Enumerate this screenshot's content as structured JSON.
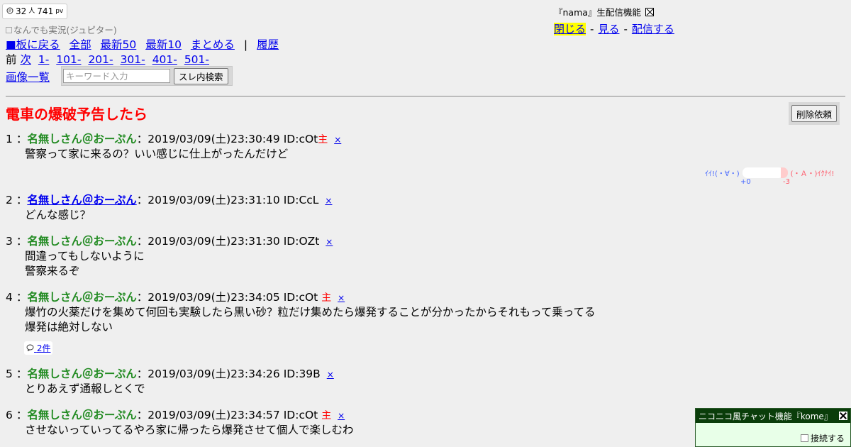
{
  "counter": {
    "people": "32",
    "people_unit": "人",
    "pv": "741",
    "pv_unit": "pv"
  },
  "board_name": "なんでも実況(ジュピター)",
  "nav": {
    "back_to_board": "■板に戻る",
    "all": "全部",
    "latest50": "最新50",
    "latest10": "最新10",
    "summarize": "まとめる",
    "separator": "|",
    "history": "履歴",
    "prev": "前",
    "next": "次",
    "ranges": [
      "1-",
      "101-",
      "201-",
      "301-",
      "401-",
      "501-"
    ],
    "gallery": "画像一覧"
  },
  "search": {
    "placeholder": "キーワード入力",
    "button": "スレ内検索"
  },
  "nama": {
    "title": "『nama』生配信機能",
    "close": "閉じる",
    "watch": "見る",
    "broadcast": "配信する",
    "dash": "-"
  },
  "thread": {
    "title": "電車の爆破予告したら",
    "delete_request": "削除依頼"
  },
  "posts": [
    {
      "no": "1",
      "name": "名無しさん＠おーぷん",
      "date": "2019/03/09(土)23:30:49",
      "id": "ID:cOt",
      "owner": "主",
      "del": "×",
      "lines": [
        "警察って家に来るの？いい感じに仕上がったんだけど"
      ]
    },
    {
      "no": "2",
      "name": "名無しさん＠おーぷん",
      "date": "2019/03/09(土)23:31:10",
      "id": "ID:CcL",
      "owner": "",
      "del": "×",
      "lines": [
        "どんな感じ？"
      ]
    },
    {
      "no": "3",
      "name": "名無しさん＠おーぷん",
      "date": "2019/03/09(土)23:31:30",
      "id": "ID:OZt",
      "owner": "",
      "del": "×",
      "lines": [
        "間違ってもしないように",
        "警察来るぞ"
      ]
    },
    {
      "no": "4",
      "name": "名無しさん＠おーぷん",
      "date": "2019/03/09(土)23:34:05",
      "id": "ID:cOt",
      "owner": "主",
      "del": "×",
      "lines": [
        "爆竹の火薬だけを集めて何回も実験したら黒い砂？粒だけ集めたら爆発することが分かったからそれもって乗ってる",
        "爆発は絶対しない"
      ]
    },
    {
      "no": "5",
      "name": "名無しさん＠おーぷん",
      "date": "2019/03/09(土)23:34:26",
      "id": "ID:39B",
      "owner": "",
      "del": "×",
      "lines": [
        "とりあえず通報しとくで"
      ]
    },
    {
      "no": "6",
      "name": "名無しさん＠おーぷん",
      "date": "2019/03/09(土)23:34:57",
      "id": "ID:cOt",
      "owner": "主",
      "del": "×",
      "lines": [
        "させないっていってるやろ家に帰ったら爆発させて個人で楽しむわ"
      ]
    }
  ],
  "post_sep": "：",
  "vote": {
    "good_label": "ｲｲ!(・∀・)",
    "bad_label": "(・Ａ・)ｲｸﾅｲ!",
    "good_count": "+0",
    "bad_count": "-3"
  },
  "reply_count": "2件",
  "kome": {
    "title": "ニコニコ風チャット機能『kome』",
    "connect": "接続する"
  },
  "colors": {
    "name_green": "#228b22",
    "link_blue": "#0000ee",
    "title_red": "#ff0000",
    "highlight_yellow": "#ffff00",
    "kome_bar": "#0a3d0a"
  }
}
